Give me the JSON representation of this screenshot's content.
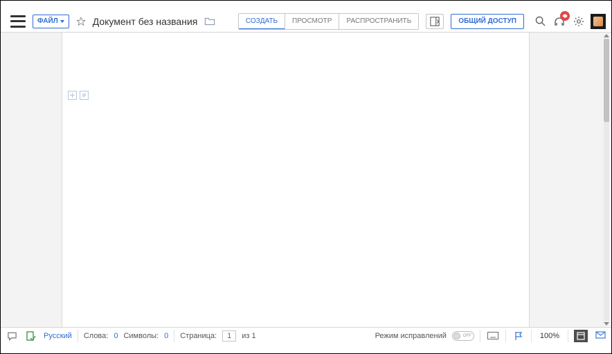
{
  "header": {
    "file_btn_label": "ФАЙЛ",
    "doc_title": "Документ без названия",
    "modes": {
      "create": "СОЗДАТЬ",
      "view": "ПРОСМОТР",
      "distribute": "РАСПРОСТРАНИТЬ"
    },
    "share_label": "ОБЩИЙ ДОСТУП"
  },
  "footer": {
    "language": "Русский",
    "words_label": "Слова:",
    "words_value": "0",
    "chars_label": "Символы:",
    "chars_value": "0",
    "page_label": "Страница:",
    "page_current": "1",
    "page_of": "из 1",
    "review_mode_label": "Режим исправлений",
    "toggle_state": "OFF",
    "zoom": "100%"
  }
}
